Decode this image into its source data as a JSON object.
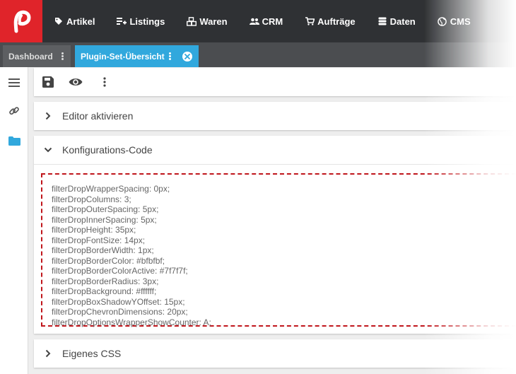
{
  "brand": {
    "accent": "#e0242a",
    "tab_active": "#31a8dd",
    "topbar_bg": "#2f3134",
    "error_border": "#c0161c"
  },
  "nav": [
    {
      "label": "Artikel",
      "icon": "tag-icon"
    },
    {
      "label": "Listings",
      "icon": "listings-icon"
    },
    {
      "label": "Waren",
      "icon": "boxes-icon"
    },
    {
      "label": "CRM",
      "icon": "people-icon"
    },
    {
      "label": "Aufträge",
      "icon": "cart-icon"
    },
    {
      "label": "Daten",
      "icon": "database-icon"
    },
    {
      "label": "CMS",
      "icon": "globe-icon"
    }
  ],
  "tabs": [
    {
      "label": "Dashboard"
    },
    {
      "label": "Plugin-Set-Übersicht"
    }
  ],
  "sidebar": [
    "menu-icon",
    "link-icon",
    "folder-icon"
  ],
  "toolbar": [
    "save-icon",
    "eye-icon",
    "more-vertical-icon"
  ],
  "panels": {
    "editor": {
      "title": "Editor aktivieren"
    },
    "config": {
      "title": "Konfigurations-Code"
    },
    "css": {
      "title": "Eigenes CSS"
    }
  },
  "code_lines": [
    "filterDropWrapperSpacing: 0px;",
    "filterDropColumns: 3;",
    "filterDropOuterSpacing: 5px;",
    "filterDropInnerSpacing: 5px;",
    "filterDropHeight: 35px;",
    "filterDropFontSize: 14px;",
    "filterDropBorderWidth: 1px;",
    "filterDropBorderColor: #bfbfbf;",
    "filterDropBorderColorActive: #7f7f7f;",
    "filterDropBorderRadius: 3px;",
    "filterDropBackground: #ffffff;",
    "filterDropBoxShadowYOffset: 15px;",
    "filterDropChevronDimensions: 20px;",
    "filterDropOptionsWrapperShowCounter: A;"
  ]
}
